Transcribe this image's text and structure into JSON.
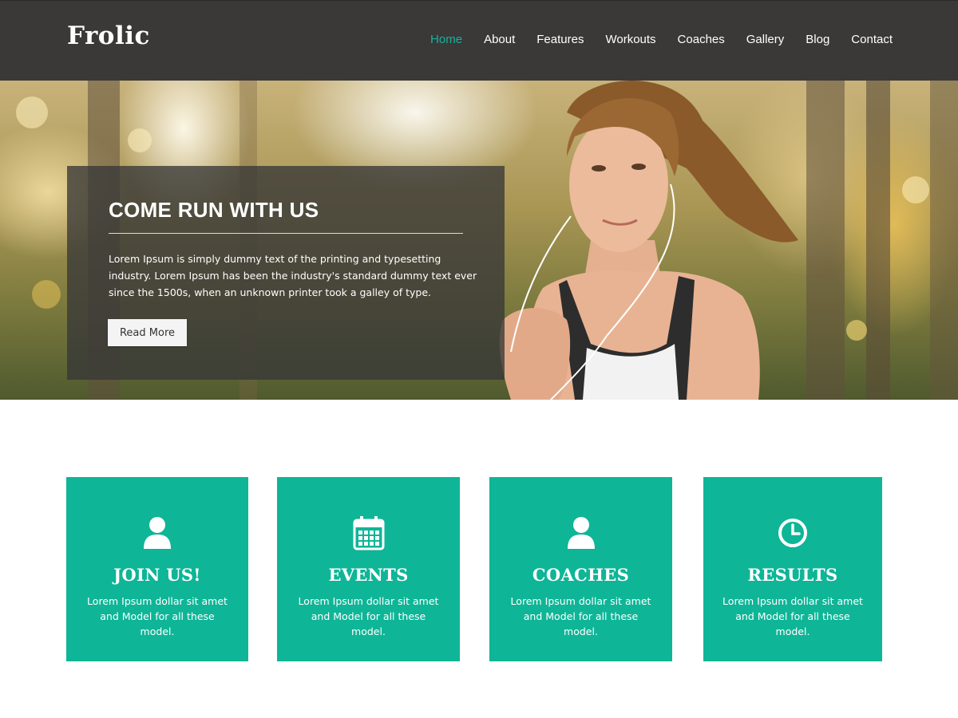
{
  "site": {
    "logo": "Frolic"
  },
  "nav": {
    "items": [
      {
        "label": "Home",
        "active": true
      },
      {
        "label": "About"
      },
      {
        "label": "Features"
      },
      {
        "label": "Workouts"
      },
      {
        "label": "Coaches"
      },
      {
        "label": "Gallery"
      },
      {
        "label": "Blog"
      },
      {
        "label": "Contact"
      }
    ]
  },
  "hero": {
    "title": "COME RUN WITH US",
    "text": "Lorem Ipsum is simply dummy text of the printing and typesetting industry. Lorem Ipsum has been the industry's standard dummy text ever since the 1500s, when an unknown printer took a galley of type.",
    "button": "Read More"
  },
  "features": [
    {
      "icon": "user-icon",
      "title": "JOIN US!",
      "desc": "Lorem Ipsum dollar sit amet and Model for all these model."
    },
    {
      "icon": "calendar-icon",
      "title": "EVENTS",
      "desc": "Lorem Ipsum dollar sit amet and Model for all these model."
    },
    {
      "icon": "user-icon",
      "title": "COACHES",
      "desc": "Lorem Ipsum dollar sit amet and Model for all these model."
    },
    {
      "icon": "clock-icon",
      "title": "RESULTS",
      "desc": "Lorem Ipsum dollar sit amet and Model for all these model."
    }
  ],
  "colors": {
    "header_bg": "#3b3838",
    "accent": "#14b39a",
    "card_bg": "#0fb597"
  }
}
